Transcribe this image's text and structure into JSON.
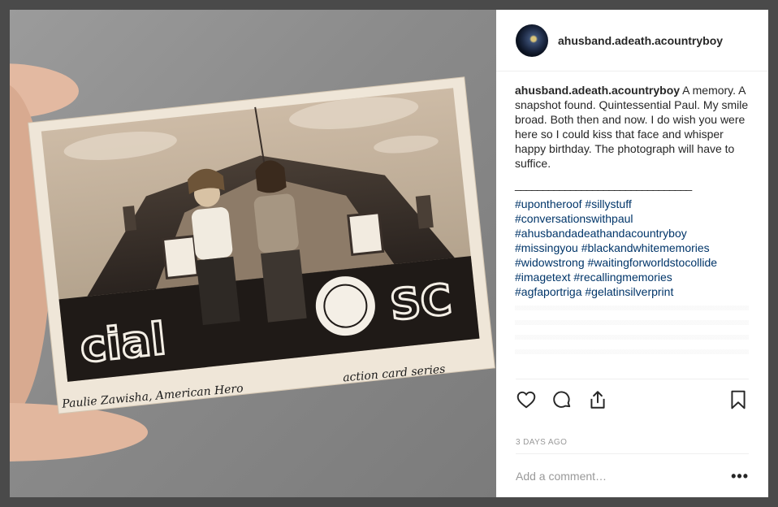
{
  "post": {
    "username": "ahusband.adeath.acountryboy",
    "caption_text": " A memory. A snapshot found. Quintessential Paul. My smile broad. Both then and now. I do wish you were here so I could kiss that face and whisper happy birthday. The photograph will have to suffice.",
    "divider": "________________________________",
    "hashtags": [
      "#upontheroof #sillystuff",
      "#conversationswithpaul",
      "#ahusbandadeathandacountryboy",
      "#missingyou #blackandwhitememories",
      "#widowstrong #waitingforworldstocollide",
      "#imagetext #recallingmemories",
      "#agfaportriga #gelatinsilverprint"
    ],
    "timestamp": "3 DAYS AGO"
  },
  "comment": {
    "placeholder": "Add a comment…",
    "more_label": "•••"
  },
  "photo": {
    "caption_left": "Paulie Zawisha, American Hero",
    "caption_right": "action card series",
    "sign_left": "cial",
    "sign_right": "SC"
  },
  "icons": {
    "heart": "heart-icon",
    "comment": "comment-icon",
    "share": "share-icon",
    "bookmark": "bookmark-icon",
    "more": "more-icon"
  },
  "colors": {
    "hashtag": "#003569",
    "text": "#262626",
    "muted": "#999999",
    "backdrop": "#4a4a4a"
  }
}
